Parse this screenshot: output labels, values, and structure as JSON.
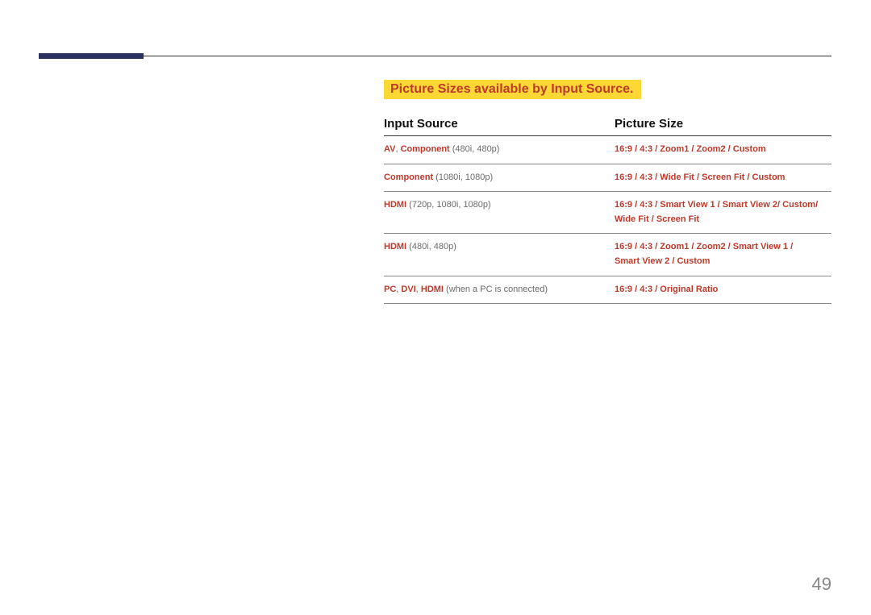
{
  "page_number": "49",
  "section_title": "Picture Sizes available by Input Source.",
  "table": {
    "headers": [
      "Input Source",
      "Picture Size"
    ],
    "rows": [
      {
        "input": [
          {
            "text": "AV",
            "cls": "red"
          },
          {
            "text": ", ",
            "cls": "gray"
          },
          {
            "text": "Component",
            "cls": "red"
          },
          {
            "text": " (480i, 480p)",
            "cls": "gray"
          }
        ],
        "size": [
          {
            "text": "16:9",
            "cls": "red"
          },
          {
            "text": " / ",
            "cls": "sep"
          },
          {
            "text": "4:3",
            "cls": "red"
          },
          {
            "text": " / ",
            "cls": "sep"
          },
          {
            "text": "Zoom1",
            "cls": "red"
          },
          {
            "text": " / ",
            "cls": "sep"
          },
          {
            "text": "Zoom2",
            "cls": "red"
          },
          {
            "text": " / ",
            "cls": "sep"
          },
          {
            "text": "Custom",
            "cls": "red"
          }
        ]
      },
      {
        "input": [
          {
            "text": "Component",
            "cls": "red"
          },
          {
            "text": " (1080i, 1080p)",
            "cls": "gray"
          }
        ],
        "size": [
          {
            "text": "16:9",
            "cls": "red"
          },
          {
            "text": " / ",
            "cls": "sep"
          },
          {
            "text": "4:3",
            "cls": "red"
          },
          {
            "text": " / ",
            "cls": "sep"
          },
          {
            "text": "Wide Fit",
            "cls": "red"
          },
          {
            "text": " / ",
            "cls": "sep"
          },
          {
            "text": "Screen Fit",
            "cls": "red"
          },
          {
            "text": " / ",
            "cls": "sep"
          },
          {
            "text": "Custom",
            "cls": "red"
          }
        ]
      },
      {
        "input": [
          {
            "text": "HDMI",
            "cls": "red"
          },
          {
            "text": " (720p, 1080i, 1080p)",
            "cls": "gray"
          }
        ],
        "size": [
          {
            "text": "16:9",
            "cls": "red"
          },
          {
            "text": " / ",
            "cls": "sep"
          },
          {
            "text": "4:3",
            "cls": "red"
          },
          {
            "text": " / ",
            "cls": "sep"
          },
          {
            "text": "Smart View 1",
            "cls": "red"
          },
          {
            "text": " / ",
            "cls": "sep"
          },
          {
            "text": "Smart View 2",
            "cls": "red"
          },
          {
            "text": "/ ",
            "cls": "sep"
          },
          {
            "text": "Custom",
            "cls": "red"
          },
          {
            "text": "/ ",
            "cls": "sep"
          },
          {
            "br": true
          },
          {
            "text": "Wide Fit",
            "cls": "red"
          },
          {
            "text": " / ",
            "cls": "sep"
          },
          {
            "text": "Screen Fit",
            "cls": "red"
          }
        ]
      },
      {
        "input": [
          {
            "text": "HDMI",
            "cls": "red"
          },
          {
            "text": " (480i, 480p)",
            "cls": "gray"
          }
        ],
        "size": [
          {
            "text": "16:9",
            "cls": "red"
          },
          {
            "text": " / ",
            "cls": "sep"
          },
          {
            "text": "4:3",
            "cls": "red"
          },
          {
            "text": " / ",
            "cls": "sep"
          },
          {
            "text": "Zoom1",
            "cls": "red"
          },
          {
            "text": " / ",
            "cls": "sep"
          },
          {
            "text": "Zoom2",
            "cls": "red"
          },
          {
            "text": " / ",
            "cls": "sep"
          },
          {
            "text": "Smart View 1",
            "cls": "red"
          },
          {
            "text": " / ",
            "cls": "sep"
          },
          {
            "br": true
          },
          {
            "text": "Smart View 2",
            "cls": "red"
          },
          {
            "text": " / ",
            "cls": "sep"
          },
          {
            "text": "Custom",
            "cls": "red"
          }
        ]
      },
      {
        "input": [
          {
            "text": "PC",
            "cls": "red"
          },
          {
            "text": ", ",
            "cls": "gray"
          },
          {
            "text": "DVI",
            "cls": "red"
          },
          {
            "text": ", ",
            "cls": "gray"
          },
          {
            "text": "HDMI",
            "cls": "red"
          },
          {
            "text": " (when a PC is connected)",
            "cls": "gray"
          }
        ],
        "size": [
          {
            "text": "16:9",
            "cls": "red"
          },
          {
            "text": " / ",
            "cls": "sep"
          },
          {
            "text": "4:3",
            "cls": "red"
          },
          {
            "text": " / ",
            "cls": "sep"
          },
          {
            "text": "Original Ratio",
            "cls": "red"
          }
        ]
      }
    ]
  }
}
